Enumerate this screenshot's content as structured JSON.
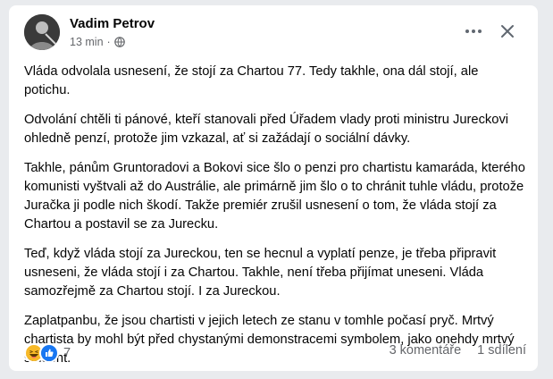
{
  "post": {
    "author": "Vadim Petrov",
    "time": "13 min",
    "separator": "·",
    "audience_icon": "globe-icon",
    "paragraphs": [
      "Vláda odvolala usnesení, že stojí za Chartou 77. Tedy takhle, ona dál stojí, ale potichu.",
      "Odvolání chtěli ti pánové, kteří stanovali před Úřadem vlady proti ministru Jureckovi ohledně penzí, protože jim vzkazal, ať si zažádají o sociální dávky.",
      "Takhle, pánům Gruntoradovi a Bokovi sice šlo o penzi pro chartistu kamaráda, kterého komunisti vyštvali až do Austrálie, ale primárně jim šlo o to chránit tuhle vládu, protože Juračka ji podle nich škodí. Takže premiér zrušil usnesení o tom, že vláda stojí za Chartou a postavil se za Jurecku.",
      "Teď, když vláda stojí za Jureckou, ten se hecnul a vyplatí penze, je třeba připravit usneseni, že vláda stojí i za Chartou. Takhle, není třeba přijímat uneseni. Vláda samozřejmě za Chartou stojí. I za Jureckou.",
      "Zaplatpanbu, že jsou chartisti v jejich letech ze stanu v tomhle počasí pryč. Mrtvý chartista by mohl být před chystanými demonstracemi symbolem, jako onehdy mrtvý student."
    ],
    "reactions": {
      "icons": [
        "haha-icon",
        "like-icon"
      ],
      "count": "7"
    },
    "comments": "3 komentáře",
    "shares": "1 sdílení"
  },
  "colors": {
    "text": "#050505",
    "secondary": "#65676b",
    "like": "#1877f2",
    "haha": "#f7b928"
  }
}
